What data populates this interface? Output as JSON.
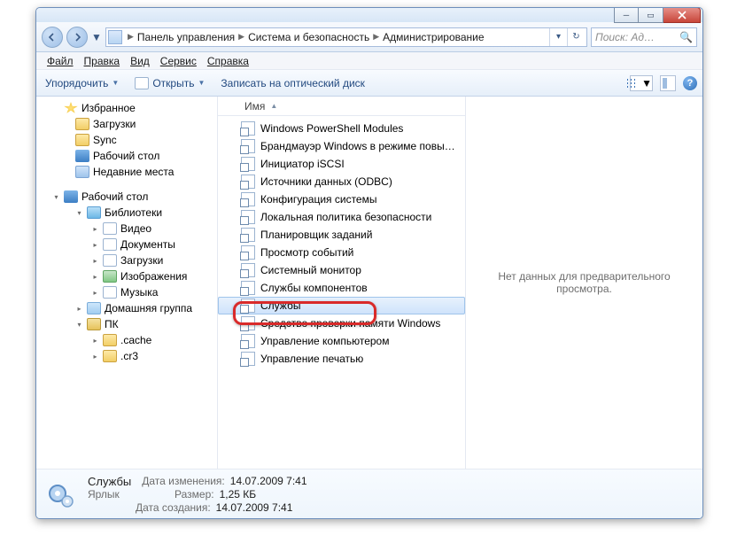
{
  "breadcrumb": [
    "Панель управления",
    "Система и безопасность",
    "Администрирование"
  ],
  "search_placeholder": "Поиск: Ад…",
  "menu": {
    "file": "Файл",
    "edit": "Правка",
    "view": "Вид",
    "tools": "Сервис",
    "help": "Справка"
  },
  "cmdbar": {
    "organize": "Упорядочить",
    "open": "Открыть",
    "burn": "Записать на оптический диск"
  },
  "tree": {
    "favorites": {
      "label": "Избранное",
      "items": [
        "Загрузки",
        "Sync",
        "Рабочий стол",
        "Недавние места"
      ]
    },
    "desktop": {
      "label": "Рабочий стол",
      "libraries": {
        "label": "Библиотеки",
        "items": [
          "Видео",
          "Документы",
          "Загрузки",
          "Изображения",
          "Музыка"
        ]
      },
      "homegroup": "Домашняя группа",
      "pc": {
        "label": "ПК",
        "items": [
          ".cache",
          ".cr3"
        ]
      }
    }
  },
  "column_header": "Имя",
  "files": [
    "Windows PowerShell Modules",
    "Брандмауэр Windows в режиме повы…",
    "Инициатор iSCSI",
    "Источники данных (ODBC)",
    "Конфигурация системы",
    "Локальная политика безопасности",
    "Планировщик заданий",
    "Просмотр событий",
    "Системный монитор",
    "Службы компонентов",
    "Службы",
    "Средство проверки памяти Windows",
    "Управление компьютером",
    "Управление печатью"
  ],
  "selected_index": 10,
  "preview_empty": "Нет данных для предварительного просмотра.",
  "details": {
    "name": "Службы",
    "type": "Ярлык",
    "labels": {
      "modified": "Дата изменения:",
      "size": "Размер:",
      "created": "Дата создания:"
    },
    "modified": "14.07.2009 7:41",
    "size": "1,25 КБ",
    "created": "14.07.2009 7:41"
  }
}
